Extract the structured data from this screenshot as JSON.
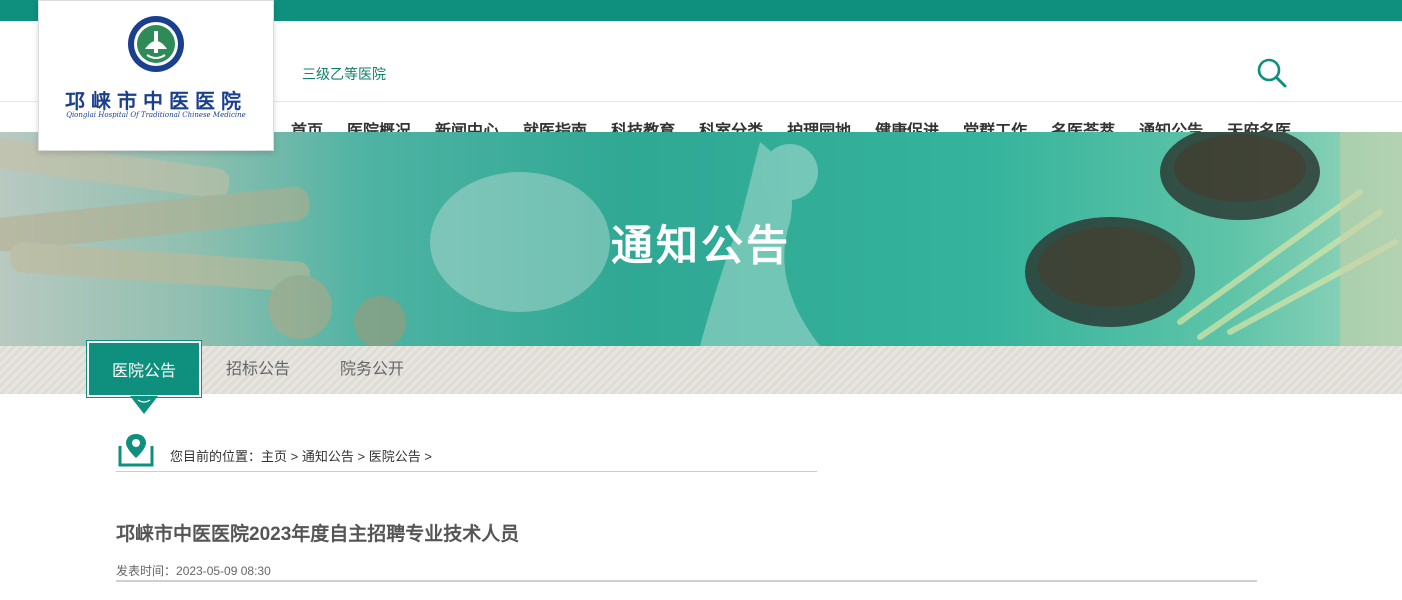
{
  "header": {
    "hospital_name_cn": "邛崃市中医医院",
    "hospital_name_en": "Qionglai Hospital Of Traditional Chinese Medicine",
    "grade": "三级乙等医院",
    "search_icon": "search-icon"
  },
  "nav": {
    "items": [
      {
        "label": "首页"
      },
      {
        "label": "医院概况"
      },
      {
        "label": "新闻中心"
      },
      {
        "label": "就医指南"
      },
      {
        "label": "科技教育"
      },
      {
        "label": "科室分类"
      },
      {
        "label": "护理园地"
      },
      {
        "label": "健康促进"
      },
      {
        "label": "党群工作"
      },
      {
        "label": "名医荟萃"
      },
      {
        "label": "通知公告",
        "active": true
      },
      {
        "label": "天府名医"
      }
    ]
  },
  "banner": {
    "title": "通知公告"
  },
  "subnav": {
    "items": [
      {
        "label": "医院公告",
        "active": true
      },
      {
        "label": "招标公告"
      },
      {
        "label": "院务公开"
      }
    ]
  },
  "breadcrumb": {
    "prefix": "您目前的位置：",
    "items": [
      "主页",
      "通知公告",
      "医院公告"
    ],
    "separator": ">"
  },
  "article": {
    "title": "邛崃市中医医院2023年度自主招聘专业技术人员",
    "date_label": "发表时间：",
    "date": "2023-05-09 08:30"
  },
  "colors": {
    "primary": "#0f8f7e",
    "accent_underline": "#c9a86a",
    "logo_text": "#1b3f8f"
  }
}
